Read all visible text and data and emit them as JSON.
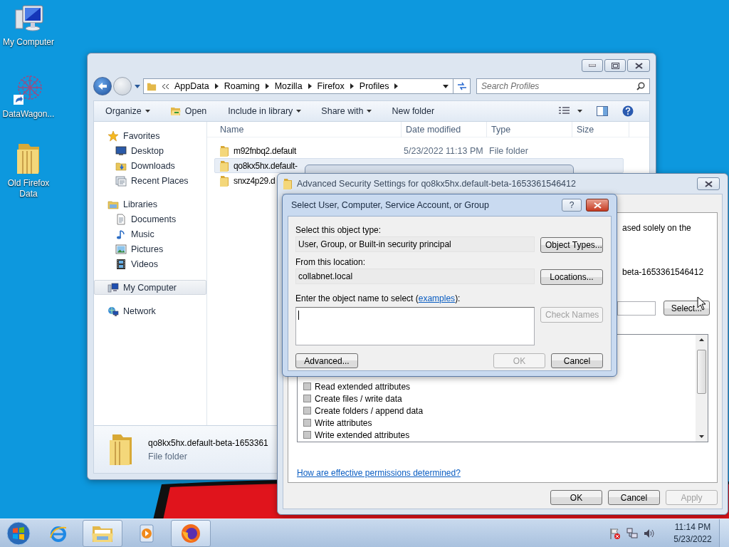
{
  "desktop_icons": [
    {
      "label": "My Computer",
      "kind": "computer"
    },
    {
      "label": "DataWagon...",
      "kind": "shortcut"
    },
    {
      "label": "Old Firefox Data",
      "kind": "folder"
    }
  ],
  "explorer": {
    "breadcrumb": [
      "AppData",
      "Roaming",
      "Mozilla",
      "Firefox",
      "Profiles"
    ],
    "search": {
      "placeholder": "Search Profiles"
    },
    "toolbar": [
      {
        "label": "Organize",
        "kind": "menu"
      },
      {
        "label": "Open",
        "kind": "open"
      },
      {
        "label": "Include in library",
        "kind": "menu"
      },
      {
        "label": "Share with",
        "kind": "menu"
      },
      {
        "label": "New folder",
        "kind": "plain"
      }
    ],
    "nav": [
      {
        "label": "Favorites",
        "kind": "star",
        "selected": false,
        "children": [
          {
            "label": "Desktop",
            "kind": "desktop",
            "selected": false
          },
          {
            "label": "Downloads",
            "kind": "downloads",
            "selected": false
          },
          {
            "label": "Recent Places",
            "kind": "recent",
            "selected": false
          }
        ]
      },
      {
        "label": "Libraries",
        "kind": "libraries",
        "selected": false,
        "children": [
          {
            "label": "Documents",
            "kind": "documents",
            "selected": false
          },
          {
            "label": "Music",
            "kind": "music",
            "selected": false
          },
          {
            "label": "Pictures",
            "kind": "pictures",
            "selected": false
          },
          {
            "label": "Videos",
            "kind": "videos",
            "selected": false
          }
        ]
      },
      {
        "label": "My Computer",
        "kind": "computer",
        "selected": true
      },
      {
        "label": "Network",
        "kind": "network",
        "selected": false
      }
    ],
    "columns": [
      "Name",
      "Date modified",
      "Type",
      "Size"
    ],
    "rows": [
      {
        "name": "m92fnbq2.default",
        "date": "5/23/2022 11:13 PM",
        "type": "File folder",
        "selected": false
      },
      {
        "name": "qo8kx5hx.default-",
        "selected": true
      },
      {
        "name": "snxz4p29.d",
        "selected": false
      }
    ],
    "details": {
      "name": "qo8kx5hx.default-beta-1653361",
      "type": "File folder"
    }
  },
  "advanced_dialog": {
    "title": "Advanced Security Settings for qo8kx5hx.default-beta-1653361546412",
    "fragments": [
      "ased solely on the",
      "beta-1653361546412"
    ],
    "select_button": "Select...",
    "permissions": [
      {
        "label": "Read extended attributes",
        "checked": false
      },
      {
        "label": "Create files / write data",
        "checked": false
      },
      {
        "label": "Create folders / append data",
        "checked": false
      },
      {
        "label": "Write attributes",
        "checked": false
      },
      {
        "label": "Write extended attributes",
        "checked": false
      }
    ],
    "link": "How are effective permissions determined?",
    "buttons": [
      {
        "label": "OK",
        "disabled": false
      },
      {
        "label": "Cancel",
        "disabled": false
      },
      {
        "label": "Apply",
        "disabled": true
      }
    ]
  },
  "select_dialog": {
    "title": "Select User, Computer, Service Account, or Group",
    "help": "?",
    "object_type_label": "Select this object type:",
    "object_type_value": "User, Group, or Built-in security principal",
    "object_types_button": "Object Types...",
    "location_label": "From this location:",
    "location_value": "collabnet.local",
    "locations_button": "Locations...",
    "name_label": "Enter the object name to select (",
    "name_link": "examples",
    "name_label_end": "):",
    "check_names": {
      "label": "Check Names",
      "disabled": true
    },
    "advanced_button": "Advanced...",
    "buttons": [
      {
        "label": "OK",
        "disabled": true
      },
      {
        "label": "Cancel",
        "disabled": false
      }
    ]
  },
  "taskbar": {
    "apps": [
      {
        "kind": "ie",
        "active": false
      },
      {
        "kind": "explorer",
        "active": true
      },
      {
        "kind": "media",
        "active": false
      },
      {
        "kind": "firefox",
        "active": true
      }
    ],
    "time": "11:14 PM",
    "date": "5/23/2022"
  }
}
